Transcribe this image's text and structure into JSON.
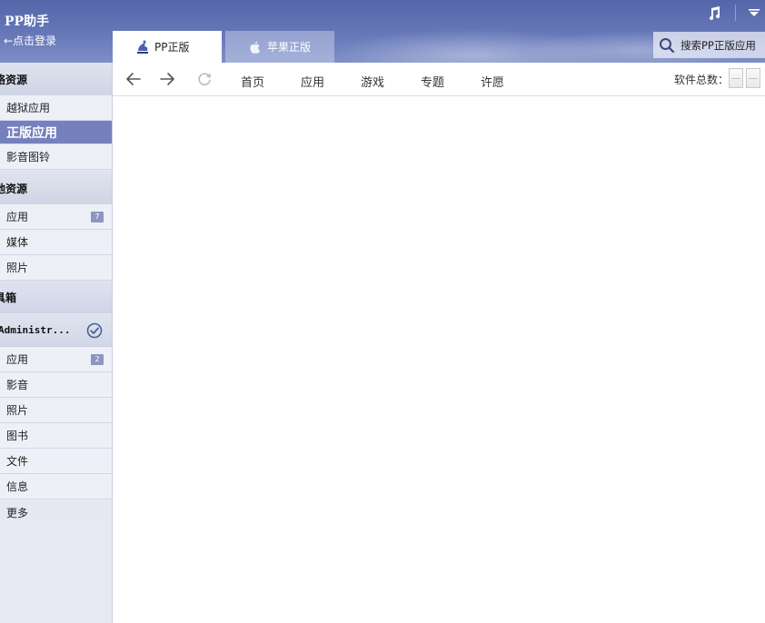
{
  "header": {
    "app_title": "PP助手",
    "login_link": "←点击登录",
    "tabs": [
      {
        "label": "PP正版",
        "active": true
      },
      {
        "label": "苹果正版",
        "active": false
      }
    ],
    "search": {
      "placeholder": "搜索PP正版应用"
    }
  },
  "sidebar": {
    "sections": [
      {
        "title": "络资源",
        "items": [
          {
            "label": "越狱应用",
            "active": false
          },
          {
            "label": "正版应用",
            "active": true
          },
          {
            "label": "影音图铃",
            "active": false
          }
        ]
      },
      {
        "title": "地资源",
        "items": [
          {
            "label": "应用",
            "badge": "7"
          },
          {
            "label": "媒体"
          },
          {
            "label": "照片"
          }
        ]
      },
      {
        "title": "具箱",
        "items": []
      }
    ],
    "device": {
      "name": "Administr...",
      "items": [
        {
          "label": "应用",
          "badge": "2"
        },
        {
          "label": "影音"
        },
        {
          "label": "照片"
        },
        {
          "label": "图书"
        },
        {
          "label": "文件"
        },
        {
          "label": "信息"
        },
        {
          "label": "更多"
        }
      ]
    }
  },
  "toolbar": {
    "nav_links": [
      "首页",
      "应用",
      "游戏",
      "专题",
      "许愿"
    ],
    "count_label": "软件总数："
  },
  "colors": {
    "header_blue": "#5466a8",
    "sidebar_active": "#7481bd",
    "badge": "#8d95c0"
  }
}
